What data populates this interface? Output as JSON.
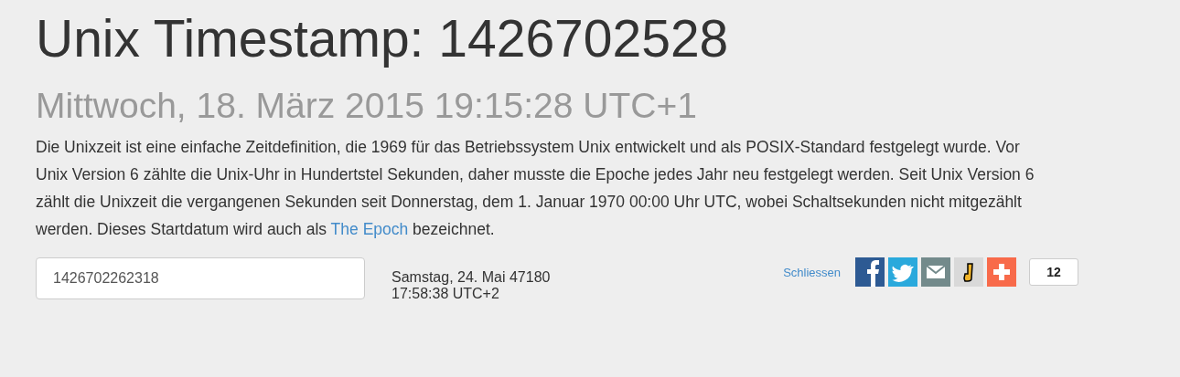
{
  "title": "Unix Timestamp: 1426702528",
  "subtitle": "Mittwoch, 18. März 2015 19:15:28 UTC+1",
  "description": {
    "text": "Die Unixzeit ist eine einfache Zeitdefinition, die 1969 für das Betriebssystem Unix entwickelt und als POSIX-Standard festgelegt wurde. Vor Unix Version 6 zählte die Unix-Uhr in Hundertstel Sekunden, daher musste die Epoche jedes Jahr neu festgelegt werden. Seit Unix Version 6 zählt die Unixzeit die vergangenen Sekunden seit Donnerstag, dem 1. Januar 1970 00:00 Uhr UTC, wobei Schaltsekunden nicht mitgezählt werden. Dieses Startdatum wird auch als",
    "link": "The Epoch",
    "text_after": "bezeichnet."
  },
  "converter": {
    "value": "1426702262318",
    "result": "Samstag, 24. Mai 47180 17:58:38 UTC+2"
  },
  "share": {
    "close_label": "Schliessen",
    "buttons": [
      {
        "kind": "facebook"
      },
      {
        "kind": "twitter"
      },
      {
        "kind": "mail"
      },
      {
        "kind": "j"
      },
      {
        "kind": "plus"
      }
    ],
    "count": "12"
  }
}
